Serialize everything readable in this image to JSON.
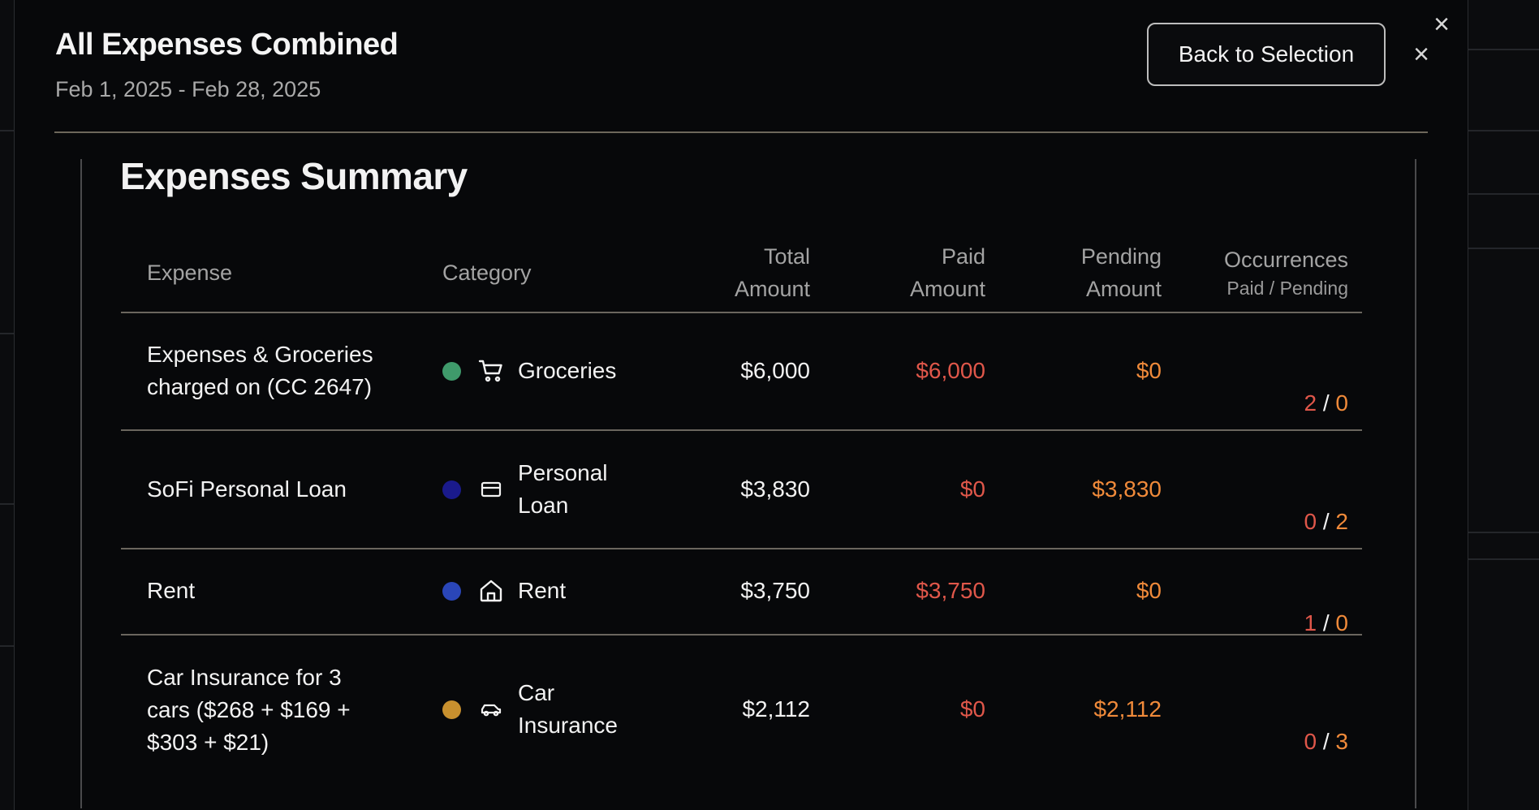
{
  "modal": {
    "title": "All Expenses Combined",
    "date_range": "Feb 1, 2025 - Feb 28, 2025",
    "back_button": "Back to Selection",
    "close_glyph": "×"
  },
  "summary": {
    "title": "Expenses Summary",
    "columns": {
      "expense": "Expense",
      "category": "Category",
      "total": [
        "Total",
        "Amount"
      ],
      "paid": [
        "Paid",
        "Amount"
      ],
      "pending": [
        "Pending",
        "Amount"
      ],
      "occurrences": "Occurrences",
      "occurrences_sub": "Paid / Pending"
    },
    "rows": [
      {
        "expense": [
          "Expenses & Groceries",
          "charged on (CC 2647)"
        ],
        "category": [
          "Groceries"
        ],
        "category_icon": "cart-icon",
        "category_color": "#3f9a6b",
        "total": "$6,000",
        "paid": "$6,000",
        "pending": "$0",
        "occ_paid": "2",
        "occ_sep": " / ",
        "occ_pending": "0"
      },
      {
        "expense": [
          "SoFi Personal Loan"
        ],
        "category": [
          "Personal",
          "Loan"
        ],
        "category_icon": "credit-card-icon",
        "category_color": "#1a1a8c",
        "total": "$3,830",
        "paid": "$0",
        "pending": "$3,830",
        "occ_paid": "0",
        "occ_sep": " / ",
        "occ_pending": "2"
      },
      {
        "expense": [
          "Rent"
        ],
        "category": [
          "Rent"
        ],
        "category_icon": "home-icon",
        "category_color": "#2a46b8",
        "total": "$3,750",
        "paid": "$3,750",
        "pending": "$0",
        "occ_paid": "1",
        "occ_sep": " / ",
        "occ_pending": "0"
      },
      {
        "expense": [
          "Car Insurance for 3",
          "cars ($268 + $169 +",
          "$303 + $21)"
        ],
        "category": [
          "Car",
          "Insurance"
        ],
        "category_icon": "car-icon",
        "category_color": "#c8902e",
        "total": "$2,112",
        "paid": "$0",
        "pending": "$2,112",
        "occ_paid": "0",
        "occ_sep": " / ",
        "occ_pending": "3"
      }
    ]
  },
  "colors": {
    "paid": "#e0574a",
    "pending": "#f08a3a",
    "divider": "#6a665e"
  }
}
